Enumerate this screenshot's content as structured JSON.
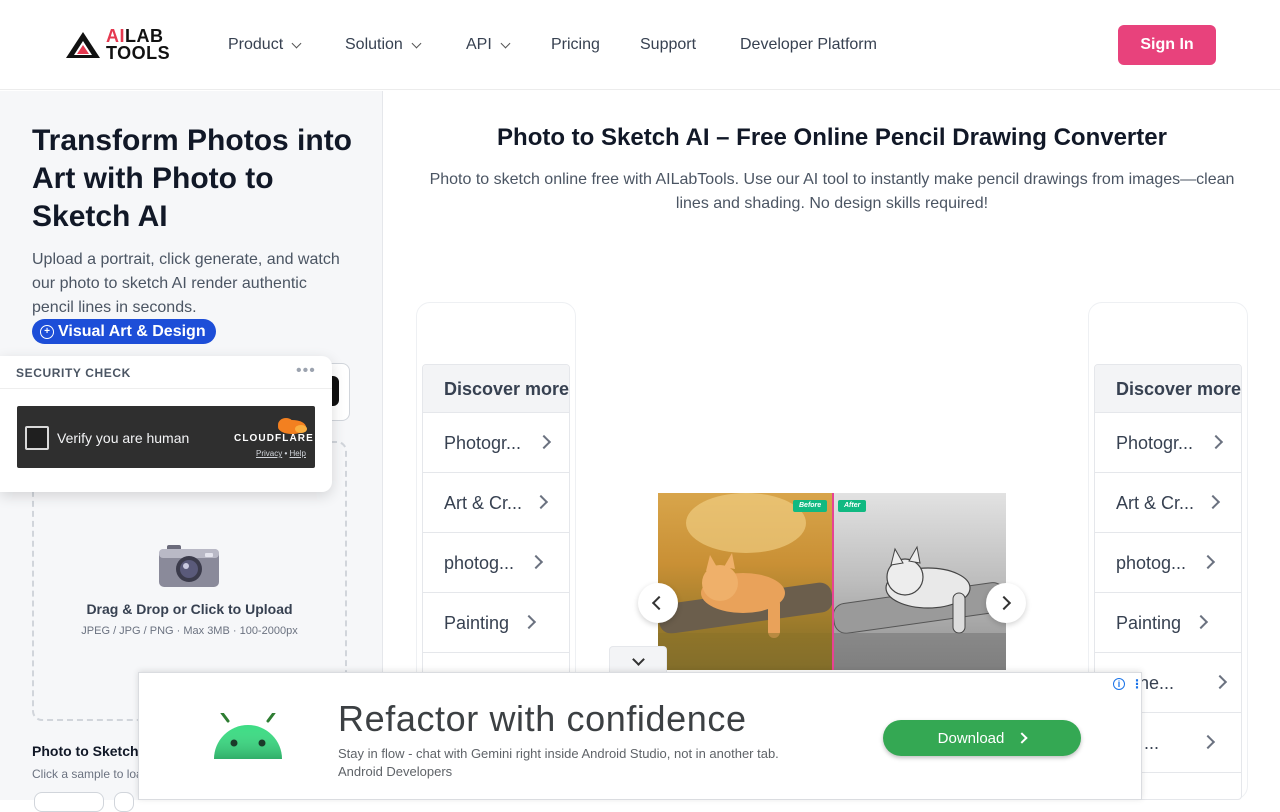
{
  "brand": {
    "line1_accent": "AI",
    "line1_rest": "LAB",
    "line2": "TOOLS"
  },
  "nav": {
    "items": [
      {
        "label": "Product",
        "has_dropdown": true
      },
      {
        "label": "Solution",
        "has_dropdown": true
      },
      {
        "label": "API",
        "has_dropdown": true
      },
      {
        "label": "Pricing",
        "has_dropdown": false
      },
      {
        "label": "Support",
        "has_dropdown": false
      },
      {
        "label": "Developer Platform",
        "has_dropdown": false
      }
    ],
    "signin_label": "Sign In"
  },
  "hero": {
    "title": "Transform Photos into Art with Photo to Sketch AI",
    "description": "Upload a portrait, click generate, and watch our photo to sketch AI render authentic pencil lines in seconds.",
    "tag": "Visual Art & Design"
  },
  "security": {
    "label": "SECURITY CHECK",
    "dots": "•••",
    "verify_label": "Verify you are human",
    "provider": "CLOUDFLARE",
    "privacy": "Privacy",
    "sep": "•",
    "help": "Help"
  },
  "upload": {
    "title": "Drag & Drop or Click to Upload",
    "subtitle": "JPEG / JPG / PNG · Max 3MB · 100-2000px"
  },
  "samples": {
    "title": "Photo to Sketch",
    "subtitle": "Click a sample to loa"
  },
  "main": {
    "title": "Photo to Sketch AI – Free Online Pencil Drawing Converter",
    "description": "Photo to sketch online free with AILabTools. Use our AI tool to instantly make pencil drawings from images—clean lines and shading. No design skills required!",
    "before_label": "Before",
    "after_label": "After"
  },
  "discover_left": {
    "heading": "Discover more",
    "items": [
      "Photogr...",
      "Art & Cr...",
      "photog...",
      "Painting"
    ]
  },
  "discover_right": {
    "heading": "Discover more",
    "items": [
      "Photogr...",
      "Art & Cr...",
      "photog...",
      "Painting",
      "chine...",
      "ice ..."
    ]
  },
  "ad": {
    "title": "Refactor with confidence",
    "description": "Stay in flow - chat with Gemini right inside Android Studio, not in another tab.",
    "sponsor": "Android Developers",
    "button": "Download",
    "info_icon": "i",
    "close_icon": "⋮"
  },
  "colors": {
    "accent_pink": "#e8427c",
    "brand_red": "#e53950",
    "tag_blue": "#1d4ed8",
    "ad_green": "#34a853",
    "divider_pink": "#e84393",
    "badge_green": "#10b981"
  },
  "icons": {
    "logo": "triangle-logo-icon",
    "camera": "camera-icon",
    "android": "android-robot-icon",
    "cloudflare": "cloudflare-cloud-icon"
  }
}
